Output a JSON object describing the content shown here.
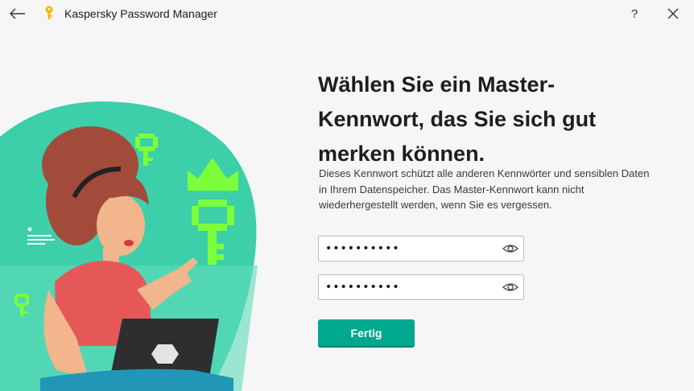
{
  "window": {
    "title": "Kaspersky Password Manager",
    "help_label": "?"
  },
  "main": {
    "heading": "Wählen Sie ein Master-Kennwort, das Sie sich gut merken können.",
    "description": "Dieses Kennwort schützt alle anderen Kennwörter und sensiblen Daten in Ihrem Datenspeicher. Das Master-Kennwort kann nicht wiederhergestellt werden, wenn Sie es vergessen.",
    "password_field": {
      "value": "••••••••••"
    },
    "confirm_field": {
      "value": "••••••••••"
    },
    "done_label": "Fertig"
  },
  "colors": {
    "accent": "#00a88e",
    "illustration_bg": "#3ccfa9",
    "pixel_green": "#7cff3a"
  },
  "icons": {
    "back": "arrow-left-icon",
    "app": "key-icon",
    "close": "close-icon",
    "reveal": "eye-icon"
  }
}
